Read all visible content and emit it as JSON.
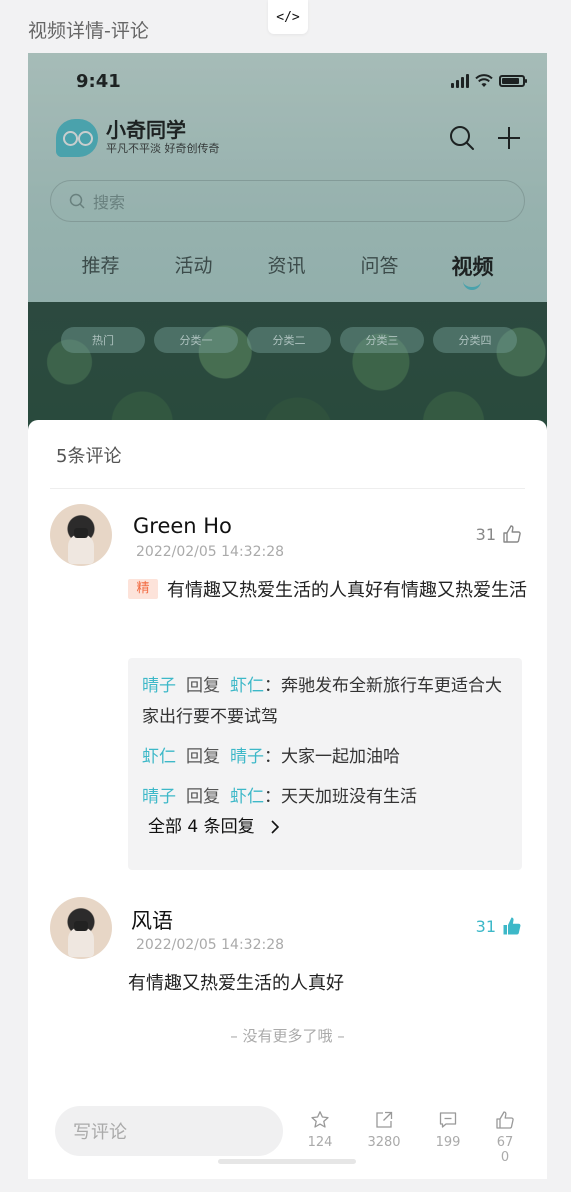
{
  "page_label": "视频详情-评论",
  "code_chip": "</>",
  "status_bar": {
    "time": "9:41"
  },
  "header": {
    "brand_name": "小奇同学",
    "brand_tagline": "平凡不平淡 好奇创传奇",
    "search_placeholder": "搜索"
  },
  "tabs": [
    "推荐",
    "活动",
    "资讯",
    "问答",
    "视频"
  ],
  "active_tab": "视频",
  "categories": [
    "热门",
    "分类一",
    "分类二",
    "分类三",
    "分类四"
  ],
  "comments_sheet": {
    "title": "5条评论",
    "comments": [
      {
        "user": "Green Ho",
        "time": "2022/02/05 14:32:28",
        "likes": "31",
        "liked": false,
        "featured_tag": "精",
        "text": "有情趣又热爱生活的人真好有情趣又热爱生活",
        "replies": [
          {
            "from": "晴子",
            "verb": "回复",
            "to": "虾仁",
            "text": "奔驰发布全新旅行车更适合大家出行要不要试驾"
          },
          {
            "from": "虾仁",
            "verb": "回复",
            "to": "晴子",
            "text": "大家一起加油哈"
          },
          {
            "from": "晴子",
            "verb": "回复",
            "to": "虾仁",
            "text": "天天加班没有生活"
          }
        ],
        "all_replies_label": "全部 4 条回复"
      },
      {
        "user": "风语",
        "time": "2022/02/05 14:32:28",
        "likes": "31",
        "liked": true,
        "text": "有情趣又热爱生活的人真好"
      }
    ],
    "no_more": "– 没有更多了哦 –"
  },
  "bottom_bar": {
    "comment_placeholder": "写评论",
    "actions": [
      {
        "icon": "star-icon",
        "count": "124"
      },
      {
        "icon": "share-icon",
        "count": "3280"
      },
      {
        "icon": "comment-icon",
        "count": "199"
      },
      {
        "icon": "thumbs-up-icon",
        "count": "670"
      }
    ]
  },
  "colors": {
    "accent": "#3db8c8",
    "featured_tag": "#f26b42"
  }
}
